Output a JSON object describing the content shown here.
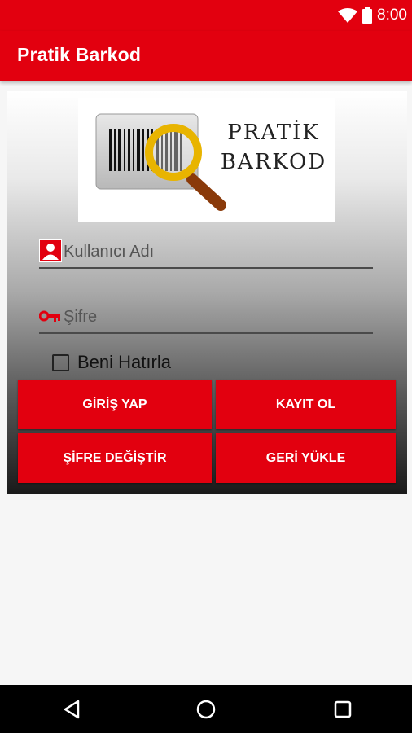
{
  "status_bar": {
    "time": "8:00",
    "icons": [
      "wifi-icon",
      "battery-icon"
    ]
  },
  "app_bar": {
    "title": "Pratik Barkod"
  },
  "logo": {
    "line1": "PRATİK",
    "line2": "BARKOD"
  },
  "form": {
    "username_placeholder": "Kullanıcı Adı",
    "password_placeholder": "Şifre",
    "remember_label": "Beni Hatırla",
    "remember_checked": false
  },
  "buttons": {
    "login": "GİRİŞ YAP",
    "register": "KAYIT OL",
    "change_password": "ŞİFRE DEĞİŞTİR",
    "restore": "GERİ YÜKLE"
  },
  "nav": {
    "items": [
      "back-icon",
      "home-icon",
      "recent-apps-icon"
    ]
  },
  "colors": {
    "accent": "#e2000f",
    "background": "#f6f6f6"
  }
}
